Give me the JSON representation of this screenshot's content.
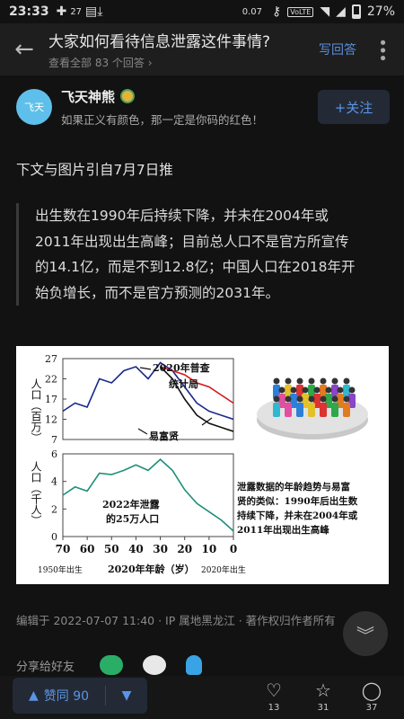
{
  "status_bar": {
    "time": "23:33",
    "notif_count": "27",
    "net_speed": "0.07",
    "net_unit": "KB/S",
    "volte": "VoLTE",
    "battery": "27%"
  },
  "header": {
    "question_title": "大家如何看待信息泄露这件事情?",
    "answers_link": "查看全部 83 个回答 ›",
    "write_answer": "写回答"
  },
  "author": {
    "avatar_text": "飞天",
    "name": "飞天神熊",
    "bio": "如果正义有颜色，那一定是你码的红色！",
    "follow_label": "+关注"
  },
  "content": {
    "intro": "下文与图片引自7月7日推",
    "quote_lines": [
      "出生数在1990年后持续下降，并未在2004年或",
      "2011年出现出生高峰；目前总人口不是官方所宣传",
      "的14.1亿，而是不到12.8亿；中国人口在2018年开",
      "始负增长，而不是官方预测的2031年。"
    ]
  },
  "chart_data": [
    {
      "type": "line",
      "ylabel": "人口（百万）",
      "yticks": [
        "27",
        "22",
        "17",
        "12",
        "7"
      ],
      "ylim": [
        7,
        27
      ],
      "x": [
        70,
        65,
        60,
        55,
        50,
        45,
        40,
        35,
        30,
        25,
        20,
        15,
        10,
        5,
        0
      ],
      "series": [
        {
          "name": "2020年普查",
          "values": [
            14,
            16,
            15,
            22,
            21,
            24,
            25,
            22,
            26,
            24,
            20,
            16,
            14,
            13,
            12
          ],
          "color": "#1a2a8c"
        },
        {
          "name": "统计局",
          "values": [
            null,
            null,
            null,
            null,
            null,
            null,
            null,
            null,
            25,
            24,
            23,
            21,
            20,
            18,
            16
          ],
          "color": "#d11a1a"
        },
        {
          "name": "易富贤",
          "values": [
            null,
            null,
            null,
            null,
            null,
            null,
            null,
            null,
            25,
            22,
            17,
            13,
            11,
            10,
            9
          ],
          "color": "#111111"
        }
      ],
      "annotations": [
        "2020年普查",
        "统计局",
        "易富贤"
      ]
    },
    {
      "type": "line",
      "ylabel": "人口（千人）",
      "yticks": [
        "6",
        "4",
        "2",
        "0"
      ],
      "ylim": [
        0,
        6
      ],
      "x": [
        70,
        65,
        60,
        55,
        50,
        45,
        40,
        35,
        30,
        25,
        20,
        15,
        10,
        5,
        0
      ],
      "series": [
        {
          "name": "2022年泄露的25万人口",
          "values": [
            3.0,
            3.6,
            3.3,
            4.6,
            4.5,
            4.8,
            5.2,
            4.8,
            5.6,
            4.8,
            3.4,
            2.4,
            1.8,
            1.2,
            0.4
          ],
          "color": "#1f8f7a"
        }
      ],
      "annotations": [
        "2022年泄露",
        "的25万人口"
      ]
    }
  ],
  "figure_text": {
    "xticks": [
      "70",
      "60",
      "50",
      "40",
      "30",
      "20",
      "10",
      "0"
    ],
    "x_left": "1950年出生",
    "x_center": "2020年年龄（岁）",
    "x_right": "2020年出生",
    "note_lines": [
      "泄露数据的年龄趋势与易富",
      "贤的类似：1990年后出生数",
      "持续下降，并未在2004年或",
      "2011年出现出生高峰"
    ]
  },
  "footer": {
    "meta": "编辑于 2022-07-07 11:40 · IP 属地黑龙江 · 著作权归作者所有",
    "share_label": "分享给好友"
  },
  "bottom_bar": {
    "upvote_label": "赞同 90",
    "like_count": "13",
    "fav_count": "31",
    "comment_count": "37"
  },
  "icons": [
    "back-arrow-icon",
    "more-icon",
    "badge-icon",
    "wechat-icon",
    "moments-icon",
    "qq-icon",
    "chevron-down-icon",
    "heart-icon",
    "star-icon",
    "comment-icon"
  ],
  "colors": {
    "accent": "#5a94e6",
    "background": "#121212"
  }
}
